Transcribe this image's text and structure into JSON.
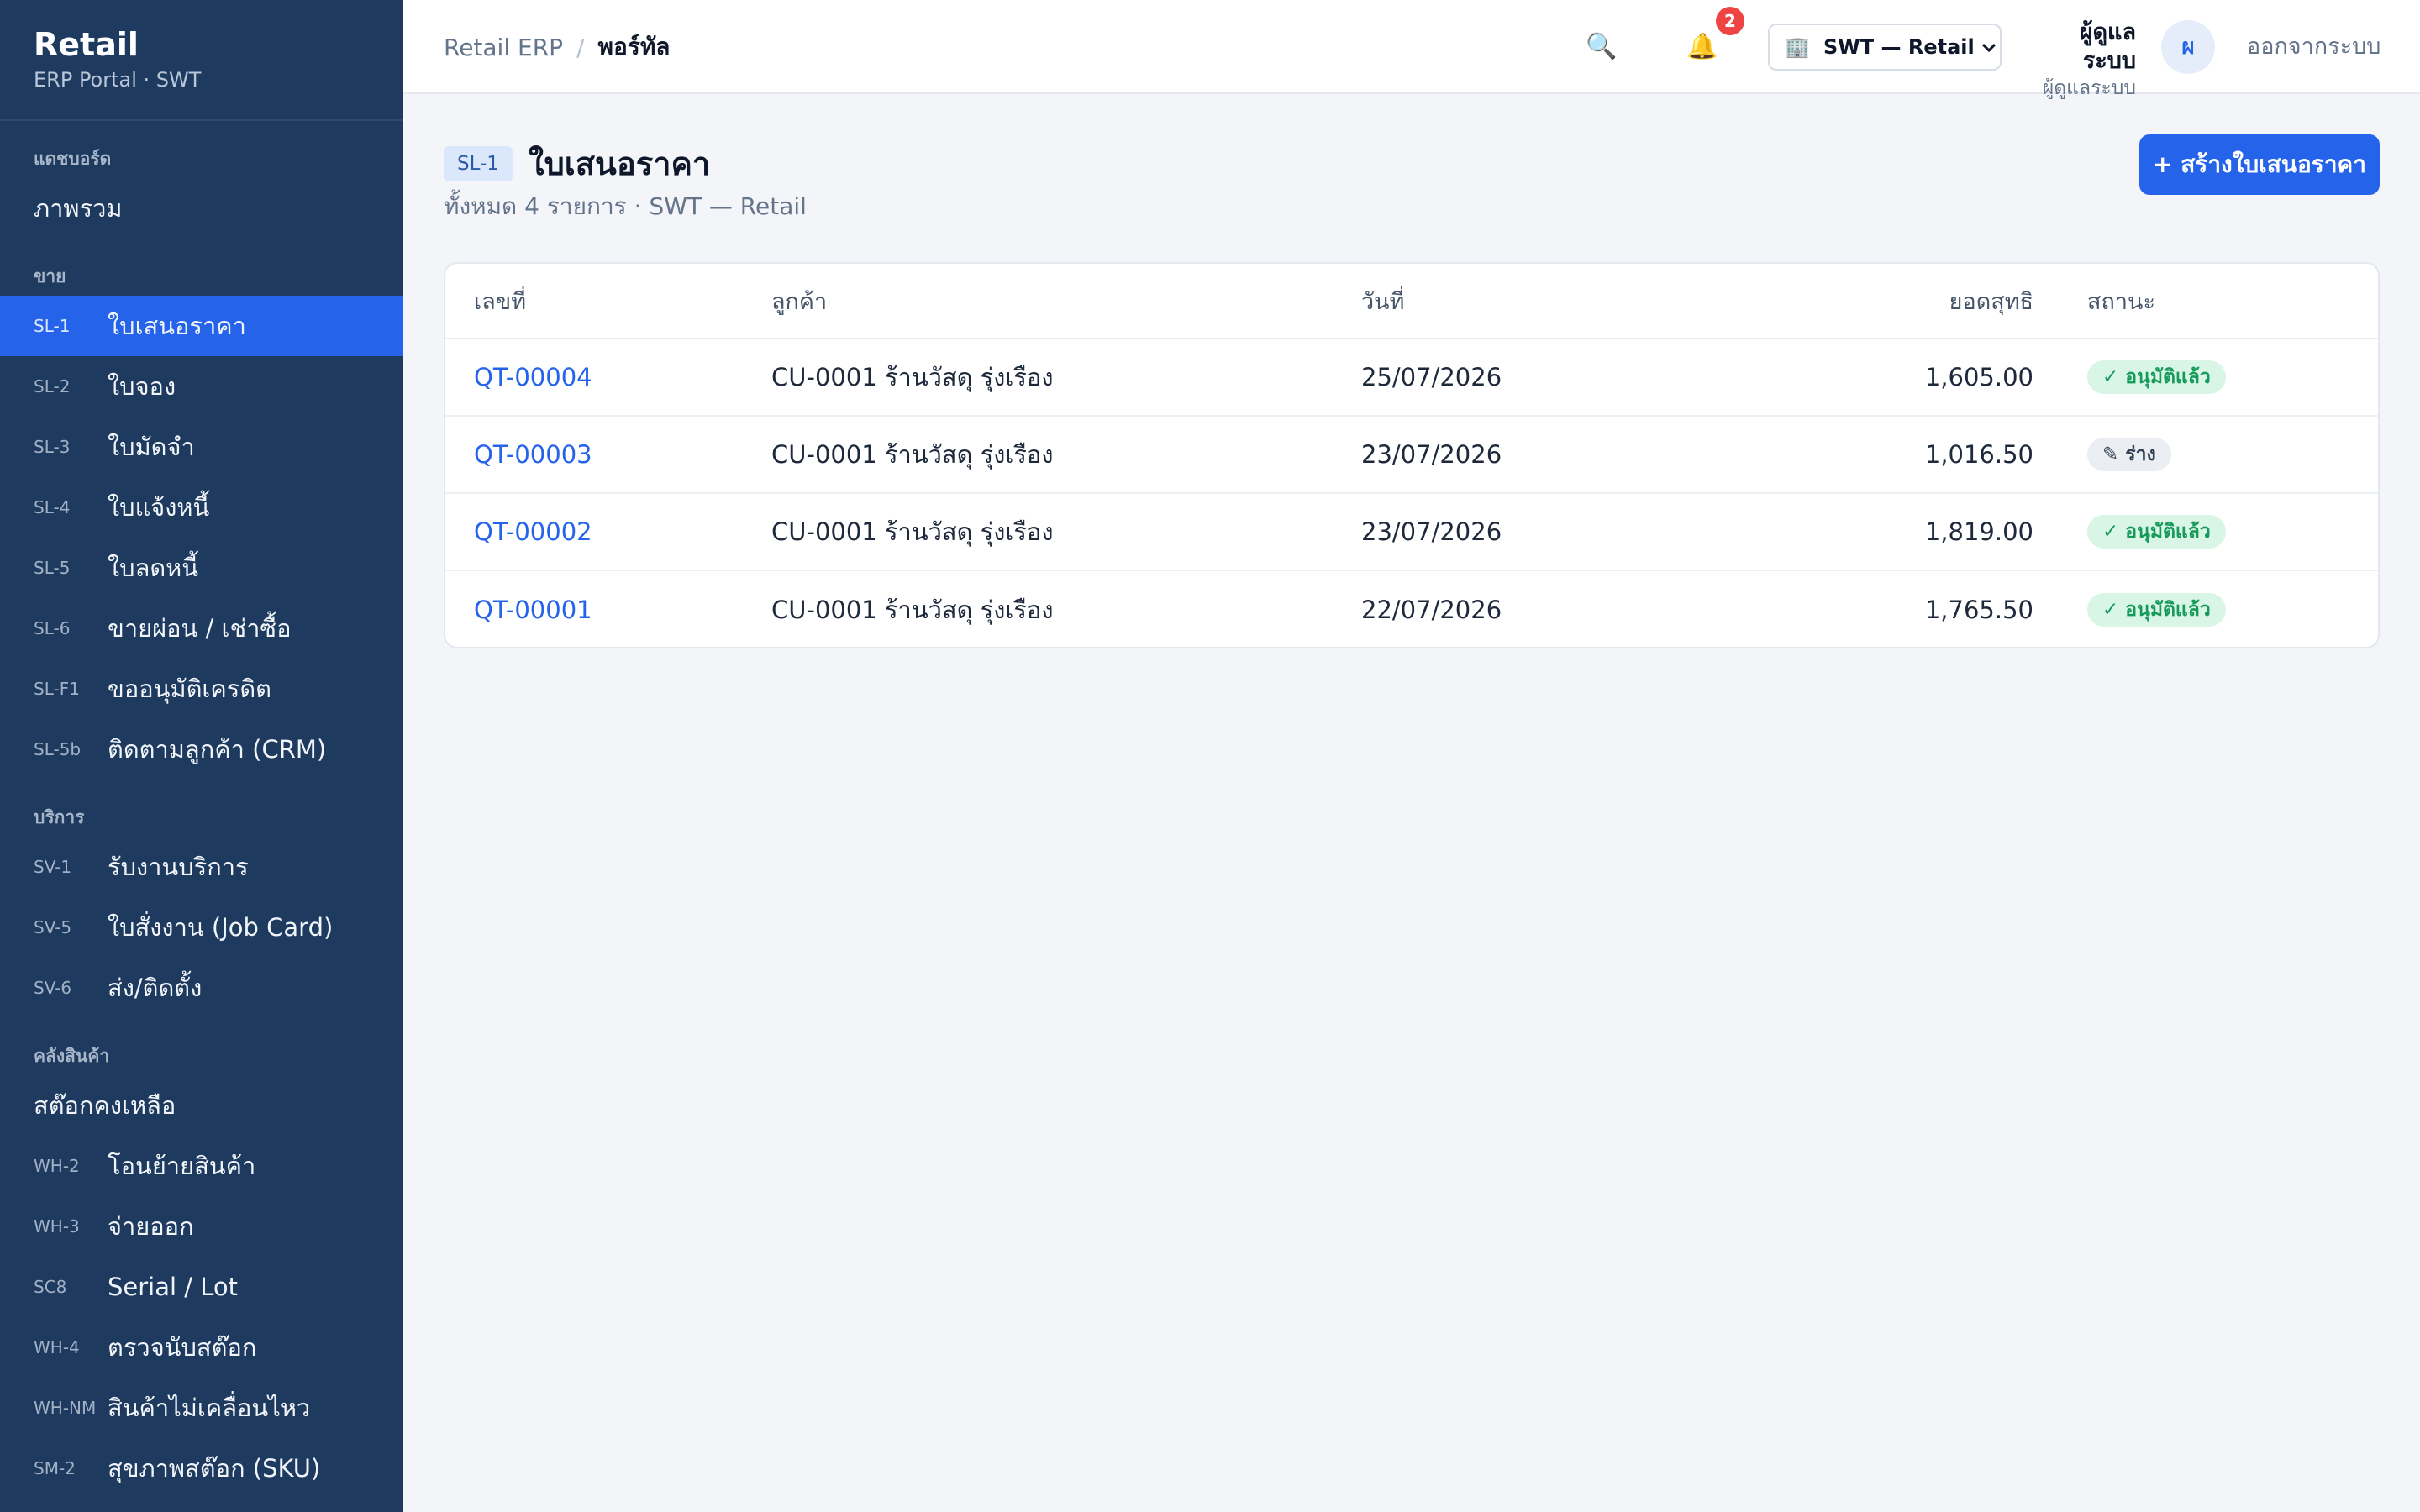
{
  "brand": {
    "title": "Retail",
    "subtitle": "ERP Portal · SWT"
  },
  "sidebar": {
    "sections": [
      {
        "title": "แดชบอร์ด",
        "items": [
          {
            "code": "",
            "label": "ภาพรวม"
          }
        ]
      },
      {
        "title": "ขาย",
        "items": [
          {
            "code": "SL-1",
            "label": "ใบเสนอราคา",
            "active": true
          },
          {
            "code": "SL-2",
            "label": "ใบจอง"
          },
          {
            "code": "SL-3",
            "label": "ใบมัดจำ"
          },
          {
            "code": "SL-4",
            "label": "ใบแจ้งหนี้"
          },
          {
            "code": "SL-5",
            "label": "ใบลดหนี้"
          },
          {
            "code": "SL-6",
            "label": "ขายผ่อน / เช่าซื้อ"
          },
          {
            "code": "SL-F1",
            "label": "ขออนุมัติเครดิต"
          },
          {
            "code": "SL-5b",
            "label": "ติดตามลูกค้า (CRM)"
          }
        ]
      },
      {
        "title": "บริการ",
        "items": [
          {
            "code": "SV-1",
            "label": "รับงานบริการ"
          },
          {
            "code": "SV-5",
            "label": "ใบสั่งงาน (Job Card)"
          },
          {
            "code": "SV-6",
            "label": "ส่ง/ติดตั้ง"
          }
        ]
      },
      {
        "title": "คลังสินค้า",
        "items": [
          {
            "code": "",
            "label": "สต๊อกคงเหลือ"
          },
          {
            "code": "WH-2",
            "label": "โอนย้ายสินค้า"
          },
          {
            "code": "WH-3",
            "label": "จ่ายออก"
          },
          {
            "code": "SC8",
            "label": "Serial / Lot"
          },
          {
            "code": "WH-4",
            "label": "ตรวจนับสต๊อก"
          },
          {
            "code": "WH-NM",
            "label": "สินค้าไม่เคลื่อนไหว"
          },
          {
            "code": "SM-2",
            "label": "สุขภาพสต๊อก (SKU)"
          }
        ]
      }
    ]
  },
  "topbar": {
    "breadcrumb_root": "Retail ERP",
    "breadcrumb_sep": "/",
    "breadcrumb_current": "พอร์ทัล",
    "search_icon": "🔍",
    "bell_icon": "🔔",
    "notification_count": "2",
    "company_icon": "🏢",
    "company_select": "SWT — Retail",
    "chevron": "⌄",
    "user_name": "ผู้ดูแลระบบ",
    "user_role": "ผู้ดูแลระบบ",
    "avatar_initial": "ผ",
    "logout": "ออกจากระบบ"
  },
  "page": {
    "code": "SL-1",
    "title": "ใบเสนอราคา",
    "subtitle": "ทั้งหมด 4 รายการ · SWT — Retail",
    "create_button": "+ สร้างใบเสนอราคา"
  },
  "table": {
    "headers": {
      "number": "เลขที่",
      "customer": "ลูกค้า",
      "date": "วันที่",
      "net": "ยอดสุทธิ",
      "status": "สถานะ"
    },
    "rows": [
      {
        "number": "QT-00004",
        "customer": "CU-0001 ร้านวัสดุ รุ่งเรือง",
        "date": "25/07/2026",
        "net": "1,605.00",
        "status": "✓ อนุมัติแล้ว",
        "status_type": "approved"
      },
      {
        "number": "QT-00003",
        "customer": "CU-0001 ร้านวัสดุ รุ่งเรือง",
        "date": "23/07/2026",
        "net": "1,016.50",
        "status": "✎ ร่าง",
        "status_type": "draft"
      },
      {
        "number": "QT-00002",
        "customer": "CU-0001 ร้านวัสดุ รุ่งเรือง",
        "date": "23/07/2026",
        "net": "1,819.00",
        "status": "✓ อนุมัติแล้ว",
        "status_type": "approved"
      },
      {
        "number": "QT-00001",
        "customer": "CU-0001 ร้านวัสดุ รุ่งเรือง",
        "date": "22/07/2026",
        "net": "1,765.50",
        "status": "✓ อนุมัติแล้ว",
        "status_type": "approved"
      }
    ]
  },
  "colors": {
    "sidebar_bg": "#1e3a5f",
    "accent": "#2563eb",
    "approved": "#159a5a",
    "badge_red": "#ef4444"
  }
}
